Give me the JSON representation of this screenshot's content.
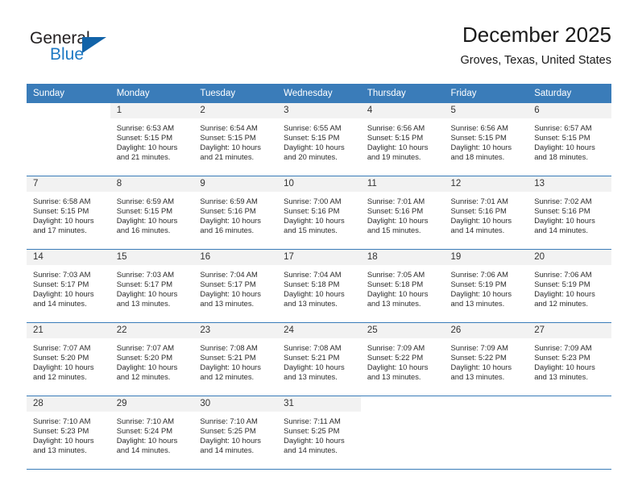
{
  "brand": {
    "name_top": "General",
    "name_bottom": "Blue",
    "colors": {
      "top_text": "#231f20",
      "bottom_text": "#1f7ac4",
      "triangle": "#1263a8"
    }
  },
  "header": {
    "title": "December 2025",
    "subtitle": "Groves, Texas, United States"
  },
  "theme": {
    "header_bar": "#3a7cb9",
    "daynum_background": "#f2f2f2",
    "row_divider": "#3a7cb9",
    "body_text": "#2b2b2b"
  },
  "columns": [
    "Sunday",
    "Monday",
    "Tuesday",
    "Wednesday",
    "Thursday",
    "Friday",
    "Saturday"
  ],
  "weeks": [
    [
      {
        "day": "",
        "sunrise": "",
        "sunset": "",
        "daylight_line1": "",
        "daylight_line2": ""
      },
      {
        "day": "1",
        "sunrise": "Sunrise: 6:53 AM",
        "sunset": "Sunset: 5:15 PM",
        "daylight_line1": "Daylight: 10 hours",
        "daylight_line2": "and 21 minutes."
      },
      {
        "day": "2",
        "sunrise": "Sunrise: 6:54 AM",
        "sunset": "Sunset: 5:15 PM",
        "daylight_line1": "Daylight: 10 hours",
        "daylight_line2": "and 21 minutes."
      },
      {
        "day": "3",
        "sunrise": "Sunrise: 6:55 AM",
        "sunset": "Sunset: 5:15 PM",
        "daylight_line1": "Daylight: 10 hours",
        "daylight_line2": "and 20 minutes."
      },
      {
        "day": "4",
        "sunrise": "Sunrise: 6:56 AM",
        "sunset": "Sunset: 5:15 PM",
        "daylight_line1": "Daylight: 10 hours",
        "daylight_line2": "and 19 minutes."
      },
      {
        "day": "5",
        "sunrise": "Sunrise: 6:56 AM",
        "sunset": "Sunset: 5:15 PM",
        "daylight_line1": "Daylight: 10 hours",
        "daylight_line2": "and 18 minutes."
      },
      {
        "day": "6",
        "sunrise": "Sunrise: 6:57 AM",
        "sunset": "Sunset: 5:15 PM",
        "daylight_line1": "Daylight: 10 hours",
        "daylight_line2": "and 18 minutes."
      }
    ],
    [
      {
        "day": "7",
        "sunrise": "Sunrise: 6:58 AM",
        "sunset": "Sunset: 5:15 PM",
        "daylight_line1": "Daylight: 10 hours",
        "daylight_line2": "and 17 minutes."
      },
      {
        "day": "8",
        "sunrise": "Sunrise: 6:59 AM",
        "sunset": "Sunset: 5:15 PM",
        "daylight_line1": "Daylight: 10 hours",
        "daylight_line2": "and 16 minutes."
      },
      {
        "day": "9",
        "sunrise": "Sunrise: 6:59 AM",
        "sunset": "Sunset: 5:16 PM",
        "daylight_line1": "Daylight: 10 hours",
        "daylight_line2": "and 16 minutes."
      },
      {
        "day": "10",
        "sunrise": "Sunrise: 7:00 AM",
        "sunset": "Sunset: 5:16 PM",
        "daylight_line1": "Daylight: 10 hours",
        "daylight_line2": "and 15 minutes."
      },
      {
        "day": "11",
        "sunrise": "Sunrise: 7:01 AM",
        "sunset": "Sunset: 5:16 PM",
        "daylight_line1": "Daylight: 10 hours",
        "daylight_line2": "and 15 minutes."
      },
      {
        "day": "12",
        "sunrise": "Sunrise: 7:01 AM",
        "sunset": "Sunset: 5:16 PM",
        "daylight_line1": "Daylight: 10 hours",
        "daylight_line2": "and 14 minutes."
      },
      {
        "day": "13",
        "sunrise": "Sunrise: 7:02 AM",
        "sunset": "Sunset: 5:16 PM",
        "daylight_line1": "Daylight: 10 hours",
        "daylight_line2": "and 14 minutes."
      }
    ],
    [
      {
        "day": "14",
        "sunrise": "Sunrise: 7:03 AM",
        "sunset": "Sunset: 5:17 PM",
        "daylight_line1": "Daylight: 10 hours",
        "daylight_line2": "and 14 minutes."
      },
      {
        "day": "15",
        "sunrise": "Sunrise: 7:03 AM",
        "sunset": "Sunset: 5:17 PM",
        "daylight_line1": "Daylight: 10 hours",
        "daylight_line2": "and 13 minutes."
      },
      {
        "day": "16",
        "sunrise": "Sunrise: 7:04 AM",
        "sunset": "Sunset: 5:17 PM",
        "daylight_line1": "Daylight: 10 hours",
        "daylight_line2": "and 13 minutes."
      },
      {
        "day": "17",
        "sunrise": "Sunrise: 7:04 AM",
        "sunset": "Sunset: 5:18 PM",
        "daylight_line1": "Daylight: 10 hours",
        "daylight_line2": "and 13 minutes."
      },
      {
        "day": "18",
        "sunrise": "Sunrise: 7:05 AM",
        "sunset": "Sunset: 5:18 PM",
        "daylight_line1": "Daylight: 10 hours",
        "daylight_line2": "and 13 minutes."
      },
      {
        "day": "19",
        "sunrise": "Sunrise: 7:06 AM",
        "sunset": "Sunset: 5:19 PM",
        "daylight_line1": "Daylight: 10 hours",
        "daylight_line2": "and 13 minutes."
      },
      {
        "day": "20",
        "sunrise": "Sunrise: 7:06 AM",
        "sunset": "Sunset: 5:19 PM",
        "daylight_line1": "Daylight: 10 hours",
        "daylight_line2": "and 12 minutes."
      }
    ],
    [
      {
        "day": "21",
        "sunrise": "Sunrise: 7:07 AM",
        "sunset": "Sunset: 5:20 PM",
        "daylight_line1": "Daylight: 10 hours",
        "daylight_line2": "and 12 minutes."
      },
      {
        "day": "22",
        "sunrise": "Sunrise: 7:07 AM",
        "sunset": "Sunset: 5:20 PM",
        "daylight_line1": "Daylight: 10 hours",
        "daylight_line2": "and 12 minutes."
      },
      {
        "day": "23",
        "sunrise": "Sunrise: 7:08 AM",
        "sunset": "Sunset: 5:21 PM",
        "daylight_line1": "Daylight: 10 hours",
        "daylight_line2": "and 12 minutes."
      },
      {
        "day": "24",
        "sunrise": "Sunrise: 7:08 AM",
        "sunset": "Sunset: 5:21 PM",
        "daylight_line1": "Daylight: 10 hours",
        "daylight_line2": "and 13 minutes."
      },
      {
        "day": "25",
        "sunrise": "Sunrise: 7:09 AM",
        "sunset": "Sunset: 5:22 PM",
        "daylight_line1": "Daylight: 10 hours",
        "daylight_line2": "and 13 minutes."
      },
      {
        "day": "26",
        "sunrise": "Sunrise: 7:09 AM",
        "sunset": "Sunset: 5:22 PM",
        "daylight_line1": "Daylight: 10 hours",
        "daylight_line2": "and 13 minutes."
      },
      {
        "day": "27",
        "sunrise": "Sunrise: 7:09 AM",
        "sunset": "Sunset: 5:23 PM",
        "daylight_line1": "Daylight: 10 hours",
        "daylight_line2": "and 13 minutes."
      }
    ],
    [
      {
        "day": "28",
        "sunrise": "Sunrise: 7:10 AM",
        "sunset": "Sunset: 5:23 PM",
        "daylight_line1": "Daylight: 10 hours",
        "daylight_line2": "and 13 minutes."
      },
      {
        "day": "29",
        "sunrise": "Sunrise: 7:10 AM",
        "sunset": "Sunset: 5:24 PM",
        "daylight_line1": "Daylight: 10 hours",
        "daylight_line2": "and 14 minutes."
      },
      {
        "day": "30",
        "sunrise": "Sunrise: 7:10 AM",
        "sunset": "Sunset: 5:25 PM",
        "daylight_line1": "Daylight: 10 hours",
        "daylight_line2": "and 14 minutes."
      },
      {
        "day": "31",
        "sunrise": "Sunrise: 7:11 AM",
        "sunset": "Sunset: 5:25 PM",
        "daylight_line1": "Daylight: 10 hours",
        "daylight_line2": "and 14 minutes."
      },
      {
        "day": "",
        "sunrise": "",
        "sunset": "",
        "daylight_line1": "",
        "daylight_line2": ""
      },
      {
        "day": "",
        "sunrise": "",
        "sunset": "",
        "daylight_line1": "",
        "daylight_line2": ""
      },
      {
        "day": "",
        "sunrise": "",
        "sunset": "",
        "daylight_line1": "",
        "daylight_line2": ""
      }
    ]
  ]
}
